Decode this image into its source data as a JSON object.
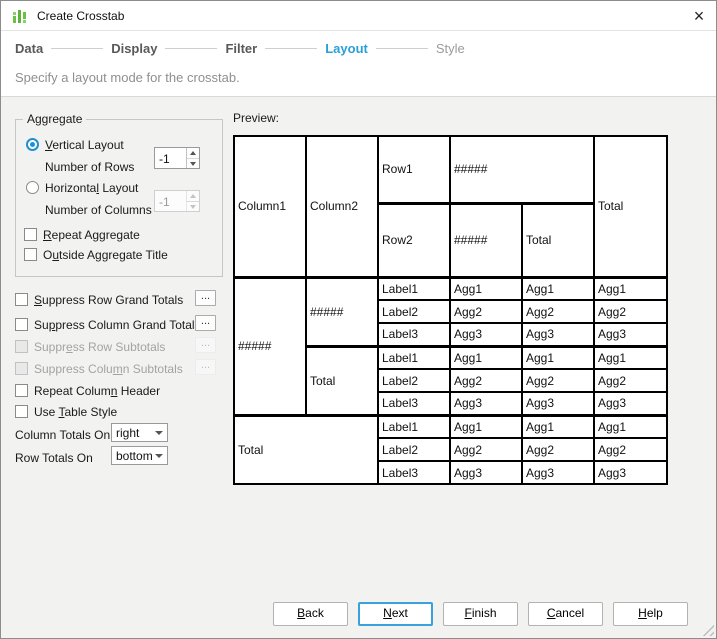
{
  "window": {
    "title": "Create Crosstab",
    "close_glyph": "×"
  },
  "wizard": {
    "steps": [
      {
        "label": "Data",
        "state": "done"
      },
      {
        "label": "Display",
        "state": "done"
      },
      {
        "label": "Filter",
        "state": "done"
      },
      {
        "label": "Layout",
        "state": "active"
      },
      {
        "label": "Style",
        "state": "future"
      }
    ],
    "subtitle": "Specify a layout mode for the crosstab."
  },
  "aggregate": {
    "title": "Aggregate",
    "vertical": {
      "pre": "",
      "key": "V",
      "post": "ertical Layout",
      "selected": true
    },
    "rows_label": "Number of Rows",
    "rows_value": "-1",
    "horizontal": {
      "pre": "Horizonta",
      "key": "l",
      "post": " Layout",
      "selected": false
    },
    "columns_label": "Number of Columns",
    "columns_value": "-1",
    "repeat": {
      "pre": "",
      "key": "R",
      "post": "epeat Aggregate",
      "checked": false
    },
    "outside": {
      "pre": "O",
      "key": "u",
      "post": "tside Aggregate Title",
      "checked": false
    }
  },
  "options": {
    "ellipsis": "...",
    "items": [
      {
        "pre": "",
        "key": "S",
        "post": "uppress Row Grand Totals",
        "enabled": true,
        "checked": false,
        "has_button": true
      },
      {
        "pre": "Su",
        "key": "p",
        "post": "press Column Grand Totals",
        "enabled": true,
        "checked": false,
        "has_button": true
      },
      {
        "pre": "Suppr",
        "key": "e",
        "post": "ss Row Subtotals",
        "enabled": false,
        "checked": false,
        "has_button": true
      },
      {
        "pre": "Suppress Colu",
        "key": "m",
        "post": "n Subtotals",
        "enabled": false,
        "checked": false,
        "has_button": true
      },
      {
        "pre": "Repeat Colum",
        "key": "n",
        "post": " Header",
        "enabled": true,
        "checked": false,
        "has_button": false
      },
      {
        "pre": "Use ",
        "key": "T",
        "post": "able Style",
        "enabled": true,
        "checked": false,
        "has_button": false
      }
    ]
  },
  "totals": {
    "column_label": "Column Totals On",
    "column_value": "right",
    "row_label": "Row Totals On",
    "row_value": "bottom"
  },
  "preview": {
    "label": "Preview:",
    "cells": {
      "column1": "Column1",
      "column2": "Column2",
      "row1": "Row1",
      "row2": "Row2",
      "hash": "#####",
      "total": "Total",
      "labels": [
        "Label1",
        "Label2",
        "Label3"
      ],
      "aggs": [
        "Agg1",
        "Agg2",
        "Agg3"
      ]
    }
  },
  "footer": {
    "buttons": [
      {
        "pre": "",
        "key": "B",
        "post": "ack",
        "variant": "normal"
      },
      {
        "pre": "",
        "key": "N",
        "post": "ext",
        "variant": "default"
      },
      {
        "pre": "",
        "key": "F",
        "post": "inish",
        "variant": "normal"
      },
      {
        "pre": "",
        "key": "C",
        "post": "ancel",
        "variant": "normal"
      },
      {
        "pre": "",
        "key": "H",
        "post": "elp",
        "variant": "normal"
      }
    ]
  },
  "colors": {
    "accent": "#2b9fd9",
    "window_bg": "#f2f2f0",
    "header_bg": "#ffffff",
    "table_border": "#000000",
    "icon_green": "#6cbf47",
    "step_done": "#595959",
    "step_future": "#9b9b9b",
    "disabled_text": "#a3a3a3"
  }
}
